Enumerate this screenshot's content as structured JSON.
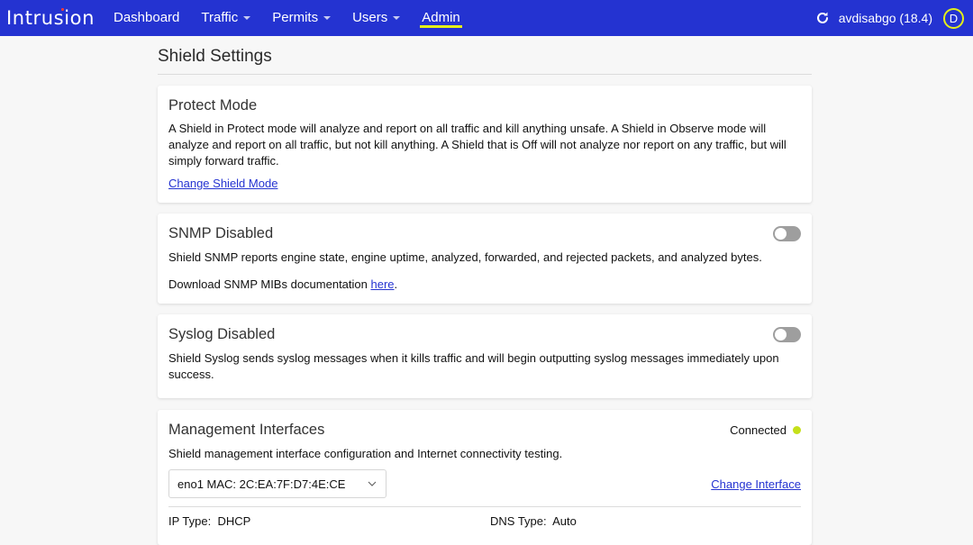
{
  "app": {
    "logo_text": "Intrusion",
    "brand_color": "#2433d1",
    "accent_color": "#e4ef18",
    "status_color": "#c5e01a"
  },
  "nav": {
    "items": [
      {
        "label": "Dashboard",
        "has_dropdown": false,
        "active": false
      },
      {
        "label": "Traffic",
        "has_dropdown": true,
        "active": false
      },
      {
        "label": "Permits",
        "has_dropdown": true,
        "active": false
      },
      {
        "label": "Users",
        "has_dropdown": true,
        "active": false
      },
      {
        "label": "Admin",
        "has_dropdown": false,
        "active": true
      }
    ],
    "refresh_icon": "refresh-icon",
    "user_label": "avdisabgo (18.4)",
    "avatar_initial": "D"
  },
  "page": {
    "title": "Shield Settings"
  },
  "protect_mode": {
    "title": "Protect Mode",
    "description": "A Shield in Protect mode will analyze and report on all traffic and kill anything unsafe. A Shield in Observe mode will analyze and report on all traffic, but not kill anything. A Shield that is Off will not analyze nor report on any traffic, but will simply forward traffic.",
    "link_label": "Change Shield Mode"
  },
  "snmp": {
    "title": "SNMP Disabled",
    "enabled": false,
    "description": "Shield SNMP reports engine state, engine uptime, analyzed, forwarded, and rejected packets, and analyzed bytes.",
    "download_prefix": "Download SNMP MIBs documentation ",
    "download_link": "here",
    "download_suffix": "."
  },
  "syslog": {
    "title": "Syslog Disabled",
    "enabled": false,
    "description": "Shield Syslog sends syslog messages when it kills traffic and will begin outputting syslog messages immediately upon success."
  },
  "management": {
    "title": "Management Interfaces",
    "status": "Connected",
    "description": "Shield management interface configuration and Internet connectivity testing.",
    "selected_interface": "eno1 MAC: 2C:EA:7F:D7:4E:CE",
    "change_link": "Change Interface",
    "ip_type_label": "IP Type:",
    "ip_type_value": "DHCP",
    "dns_type_label": "DNS Type:",
    "dns_type_value": "Auto"
  }
}
